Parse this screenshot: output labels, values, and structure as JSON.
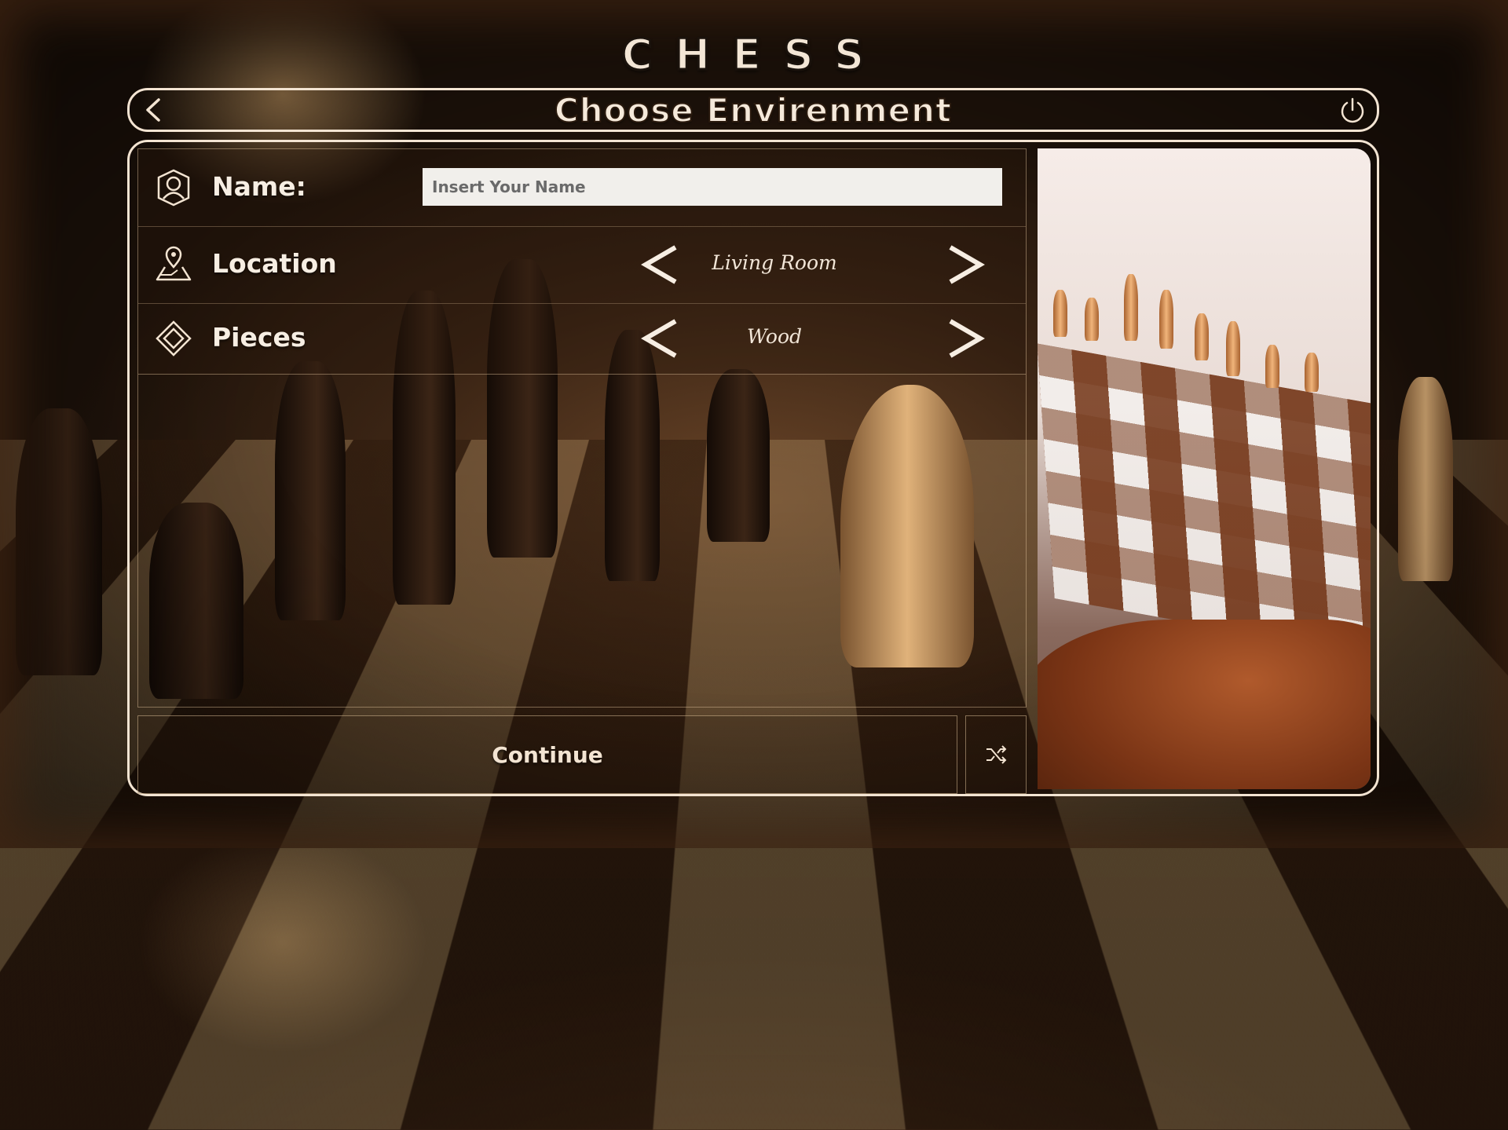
{
  "game_title": "CHESS",
  "header": {
    "title": "Choose Envirenment",
    "back_icon": "chevron-left-icon",
    "power_icon": "power-icon"
  },
  "form": {
    "name": {
      "label": "Name:",
      "icon": "user-icon",
      "placeholder": "Insert Your Name",
      "value": ""
    },
    "location": {
      "label": "Location",
      "icon": "map-pin-icon",
      "value": "Living Room"
    },
    "pieces": {
      "label": "Pieces",
      "icon": "diamond-icon",
      "value": "Wood"
    }
  },
  "actions": {
    "continue_label": "Continue",
    "shuffle_icon": "shuffle-icon"
  },
  "colors": {
    "frame": "#f3e4d2",
    "text": "#f7eee3",
    "input_bg": "#f1efeb"
  }
}
